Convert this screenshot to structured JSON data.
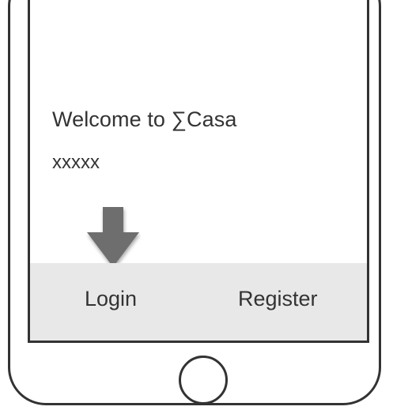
{
  "screen": {
    "welcome_text": "Welcome to ∑Casa",
    "subtitle_text": "xxxxx"
  },
  "annotation": {
    "arrow_icon": "down-arrow-icon",
    "arrow_color": "#6e6e6e"
  },
  "tab_bar": {
    "login_label": "Login",
    "register_label": "Register",
    "background_color": "#e8e8e8"
  },
  "device": {
    "frame_color": "#333333",
    "home_button_icon": "home-button-circle"
  }
}
